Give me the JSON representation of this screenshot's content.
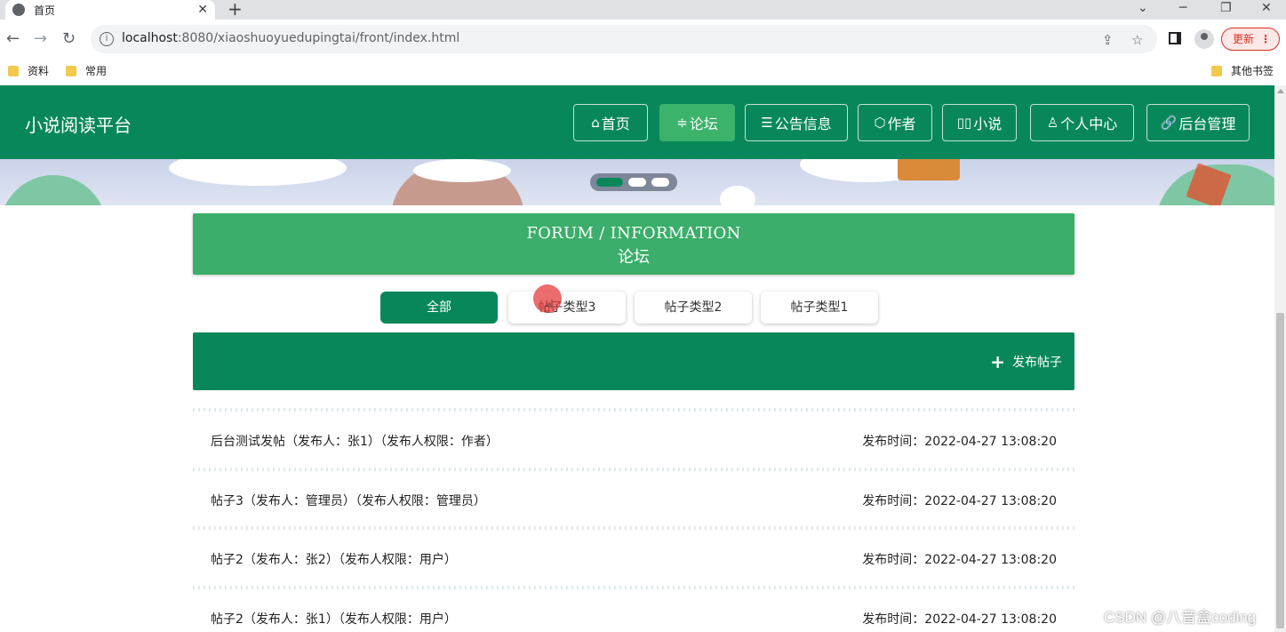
{
  "browser": {
    "tab_title": "首页",
    "tab_close": "✕",
    "new_tab": "+",
    "url_host": "localhost",
    "url_rest": ":8080/xiaoshuoyuedupingtai/front/index.html",
    "update_label": "更新",
    "bookmarks": [
      "资料",
      "常用"
    ],
    "other_bookmarks": "其他书签"
  },
  "site": {
    "brand": "小说阅读平台",
    "nav": [
      {
        "icon": "⌂",
        "label": "首页"
      },
      {
        "icon": "≑",
        "label": "论坛"
      },
      {
        "icon": "☰",
        "label": "公告信息"
      },
      {
        "icon": "⬡",
        "label": "作者"
      },
      {
        "icon": "▯▯",
        "label": "小说"
      },
      {
        "icon": "♙",
        "label": "个人中心"
      },
      {
        "icon": "🔗",
        "label": "后台管理"
      }
    ]
  },
  "forum": {
    "title_en": "FORUM / INFORMATION",
    "title_cn": "论坛",
    "filters": [
      "全部",
      "帖子类型3",
      "帖子类型2",
      "帖子类型1"
    ],
    "active_filter": "全部",
    "publish_label": "发布帖子",
    "posts": [
      {
        "title": "后台测试发帖（发布人：张1）（发布人权限：作者）",
        "time": "发布时间：2022-04-27 13:08:20"
      },
      {
        "title": "帖子3（发布人：管理员）（发布人权限：管理员）",
        "time": "发布时间：2022-04-27 13:08:20"
      },
      {
        "title": "帖子2（发布人：张2）（发布人权限：用户）",
        "time": "发布时间：2022-04-27 13:08:20"
      },
      {
        "title": "帖子2（发布人：张1）（发布人权限：用户）",
        "time": "发布时间：2022-04-27 13:08:20"
      }
    ]
  },
  "watermark": "CSDN @八音盒coding",
  "colors": {
    "primary": "#08885a",
    "accent": "#3aae6a"
  }
}
